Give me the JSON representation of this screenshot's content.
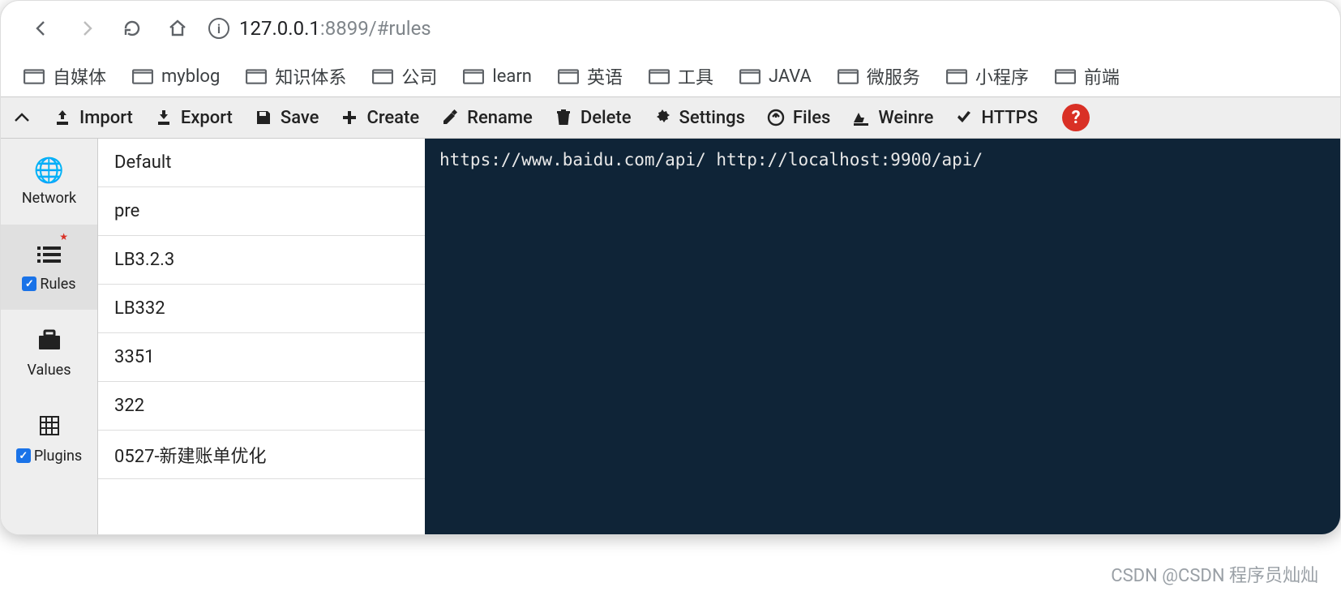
{
  "address": {
    "host": "127.0.0.1",
    "rest": ":8899/#rules"
  },
  "bookmarks": [
    "自媒体",
    "myblog",
    "知识体系",
    "公司",
    "learn",
    "英语",
    "工具",
    "JAVA",
    "微服务",
    "小程序",
    "前端"
  ],
  "toolbar": {
    "import": "Import",
    "export": "Export",
    "save": "Save",
    "create": "Create",
    "rename": "Rename",
    "delete": "Delete",
    "settings": "Settings",
    "files": "Files",
    "weinre": "Weinre",
    "https": "HTTPS"
  },
  "sidebar": {
    "items": [
      {
        "label": "Network",
        "checked": false
      },
      {
        "label": "Rules",
        "checked": true
      },
      {
        "label": "Values",
        "checked": false
      },
      {
        "label": "Plugins",
        "checked": true
      }
    ]
  },
  "rules": [
    "Default",
    "pre",
    "LB3.2.3",
    "LB332",
    "3351",
    "322",
    "0527-新建账单优化"
  ],
  "editor_content": "https://www.baidu.com/api/ http://localhost:9900/api/",
  "watermark": "CSDN @CSDN 程序员灿灿"
}
